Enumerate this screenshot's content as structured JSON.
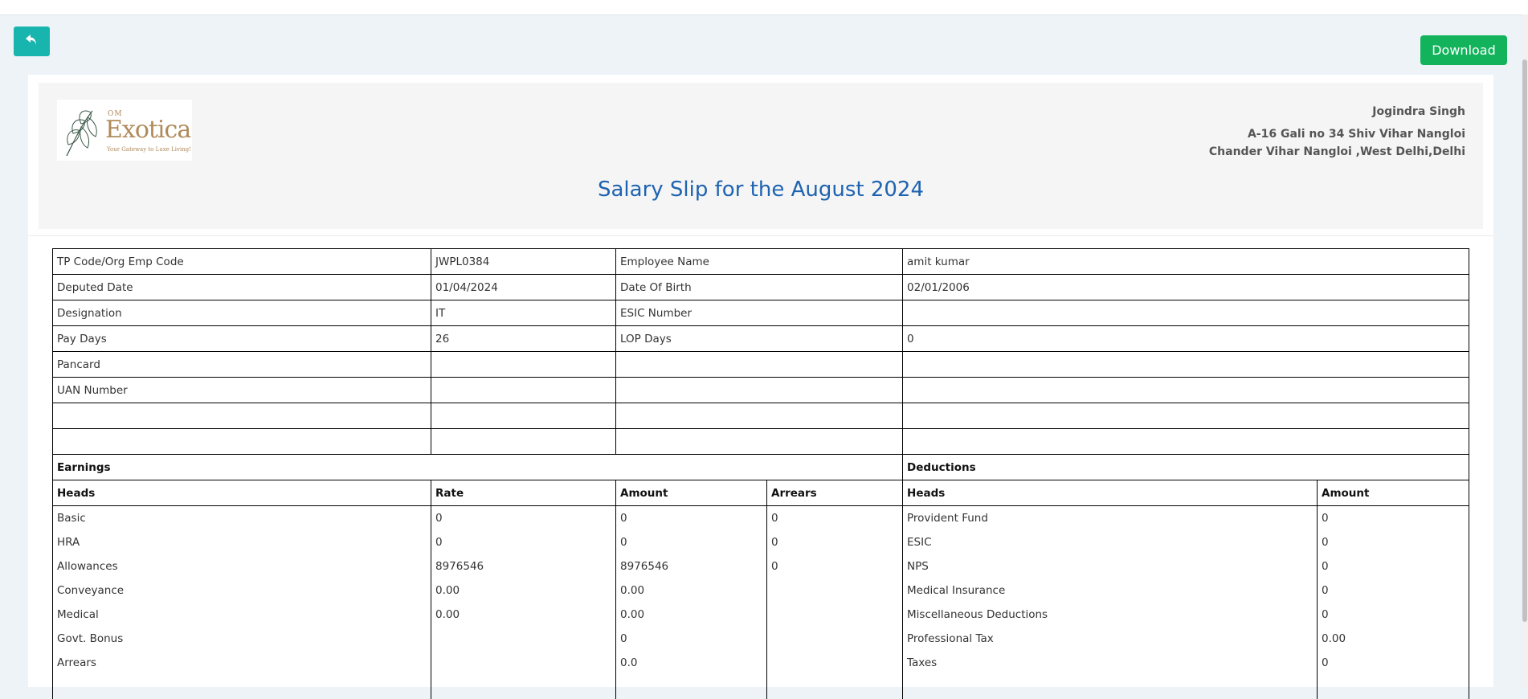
{
  "toolbar": {
    "download_label": "Download"
  },
  "company": {
    "logo_prefix": "OM",
    "logo_name": "Exotica",
    "logo_tagline": "Your Gateway to Luxe Living!",
    "name": "Jogindra Singh",
    "address_line1": "A-16 Gali no 34 Shiv Vihar Nangloi",
    "address_line2": "Chander Vihar Nangloi ,West Delhi,Delhi"
  },
  "slip_title": "Salary Slip for the August 2024",
  "employee": {
    "emp_code_label": "TP Code/Org Emp Code",
    "emp_code": "JWPL0384",
    "name_label": "Employee Name",
    "name": "amit kumar",
    "deputed_label": "Deputed Date",
    "deputed": "01/04/2024",
    "dob_label": "Date Of Birth",
    "dob": "02/01/2006",
    "designation_label": "Designation",
    "designation": "IT",
    "esic_label": "ESIC Number",
    "esic": "",
    "pay_days_label": "Pay Days",
    "pay_days": "26",
    "lop_label": "LOP Days",
    "lop": "0",
    "pancard_label": "Pancard",
    "uan_label": "UAN Number"
  },
  "sections": {
    "earnings": "Earnings",
    "deductions": "Deductions"
  },
  "columns": {
    "heads": "Heads",
    "rate": "Rate",
    "amount": "Amount",
    "arrears": "Arrears"
  },
  "earnings": [
    {
      "head": "Basic",
      "rate": "0",
      "amount": "0",
      "arrears": "0"
    },
    {
      "head": "HRA",
      "rate": "0",
      "amount": "0",
      "arrears": "0"
    },
    {
      "head": "Allowances",
      "rate": "8976546",
      "amount": "8976546",
      "arrears": "0"
    },
    {
      "head": "Conveyance",
      "rate": "0.00",
      "amount": "0.00",
      "arrears": ""
    },
    {
      "head": "Medical",
      "rate": "0.00",
      "amount": "0.00",
      "arrears": ""
    },
    {
      "head": "Govt. Bonus",
      "rate": "",
      "amount": "0",
      "arrears": ""
    },
    {
      "head": "Arrears",
      "rate": "",
      "amount": "0.0",
      "arrears": ""
    }
  ],
  "deductions": [
    {
      "head": "Provident Fund",
      "amount": "0"
    },
    {
      "head": "ESIC",
      "amount": "0"
    },
    {
      "head": "NPS",
      "amount": "0"
    },
    {
      "head": "Medical Insurance",
      "amount": "0"
    },
    {
      "head": "Miscellaneous Deductions",
      "amount": "0"
    },
    {
      "head": "Professional Tax",
      "amount": "0.00"
    },
    {
      "head": "Taxes",
      "amount": "0"
    }
  ]
}
